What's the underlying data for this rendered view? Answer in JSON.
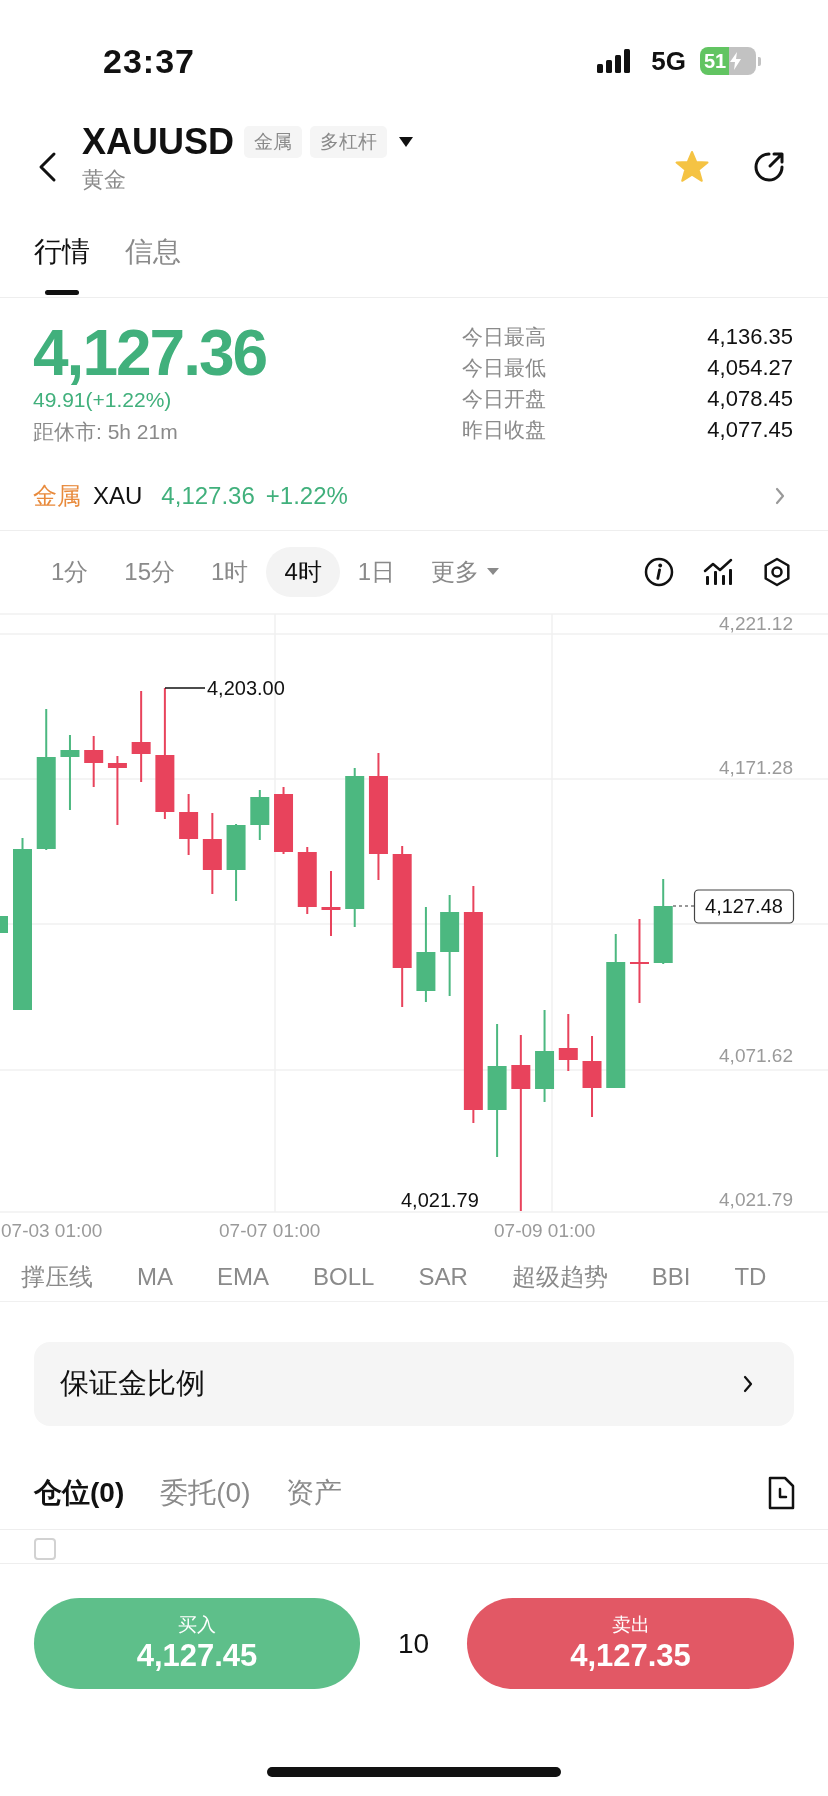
{
  "status_bar": {
    "time": "23:37",
    "network": "5G",
    "battery": "51"
  },
  "header": {
    "symbol": "XAUUSD",
    "tags": [
      "金属",
      "多杠杆"
    ],
    "subtitle": "黄金",
    "favorite": true
  },
  "tabs": [
    {
      "label": "行情",
      "selected": true
    },
    {
      "label": "信息",
      "selected": false
    }
  ],
  "quote": {
    "price": "4,127.36",
    "change": "49.91(+1.22%)",
    "countdown": "距休市: 5h 21m",
    "stats": [
      {
        "label": "今日最高",
        "value": "4,136.35"
      },
      {
        "label": "今日最低",
        "value": "4,054.27"
      },
      {
        "label": "今日开盘",
        "value": "4,078.45"
      },
      {
        "label": "昨日收盘",
        "value": "4,077.45"
      }
    ]
  },
  "related": {
    "category": "金属",
    "symbol": "XAU",
    "price": "4,127.36",
    "change": "+1.22%"
  },
  "intervals": [
    {
      "label": "1分",
      "kind": "interval",
      "selected": false
    },
    {
      "label": "15分",
      "kind": "interval",
      "selected": false
    },
    {
      "label": "1时",
      "kind": "interval",
      "selected": false
    },
    {
      "label": "4时",
      "kind": "interval",
      "selected": true
    },
    {
      "label": "1日",
      "kind": "interval",
      "selected": false
    },
    {
      "label": "更多",
      "kind": "menu",
      "selected": false
    }
  ],
  "chart": {
    "y_axis_labels": [
      "4,221.12",
      "4,171.28",
      "4,071.62",
      "4,021.79"
    ],
    "x_axis_labels": [
      "07-03 01:00",
      "07-07 01:00",
      "07-09 01:00"
    ],
    "high_label": "4,203.00",
    "low_label": "4,021.79",
    "last_price": "4,127.48"
  },
  "indicators": [
    "撑压线",
    "MA",
    "EMA",
    "BOLL",
    "SAR",
    "超级趋势",
    "BBI",
    "TD"
  ],
  "margin_card": {
    "label": "保证金比例"
  },
  "position_tabs": [
    {
      "label": "仓位(0)",
      "selected": true
    },
    {
      "label": "委托(0)",
      "selected": false
    },
    {
      "label": "资产",
      "selected": false
    }
  ],
  "filter": {
    "checked": false
  },
  "trade": {
    "buy": {
      "label": "买入",
      "price": "4,127.45"
    },
    "quantity": "10",
    "sell": {
      "label": "卖出",
      "price": "4,127.35"
    }
  }
}
